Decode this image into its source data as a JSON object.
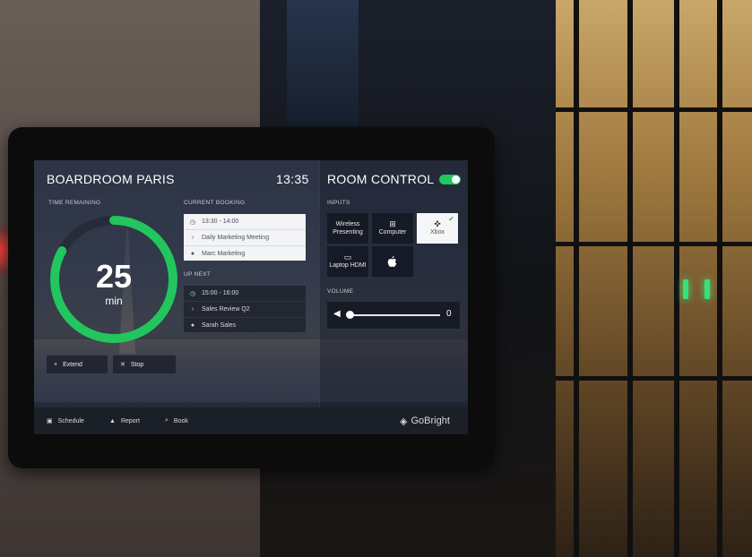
{
  "colors": {
    "accent": "#22c55e",
    "bar": "#1b1f28",
    "card_light": "#f3f4f6"
  },
  "room": {
    "name": "BOARDROOM PARIS",
    "time": "13:35"
  },
  "time_remaining": {
    "label": "TIME REMAINING",
    "value": "25",
    "unit": "min",
    "progress": 0.83
  },
  "current_booking": {
    "label": "CURRENT BOOKING",
    "time": "13:30 - 14:00",
    "title": "Daily Marketing Meeting",
    "organizer": "Marc Marketing"
  },
  "up_next": {
    "label": "UP NEXT",
    "time": "15:00 - 16:00",
    "title": "Sales Review Q2",
    "organizer": "Sarah Sales"
  },
  "actions": {
    "extend": "Extend",
    "stop": "Stop"
  },
  "room_control": {
    "title": "ROOM CONTROL",
    "toggle_on": true,
    "inputs_label": "INPUTS",
    "inputs": [
      {
        "label": "Wireless Presenting",
        "icon": "wireless-icon"
      },
      {
        "label": "Computer",
        "icon": "windows-icon"
      },
      {
        "label": "Xbox",
        "icon": "gamepad-icon",
        "selected": true
      },
      {
        "label": "Laptop HDMI",
        "icon": "laptop-icon"
      },
      {
        "label": "",
        "icon": "apple-icon"
      }
    ],
    "volume_label": "VOLUME",
    "volume_value": "0"
  },
  "bottom_bar": {
    "schedule": "Schedule",
    "report": "Report",
    "book": "Book",
    "brand": "GoBright"
  }
}
